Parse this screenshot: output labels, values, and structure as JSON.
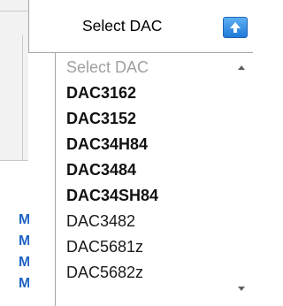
{
  "combo": {
    "selected": "Select DAC",
    "button_icon": "arrow-up-icon",
    "button_color": "#1f7ad8"
  },
  "dropdown": {
    "items": [
      {
        "label": "Select DAC",
        "style": "placeholder"
      },
      {
        "label": "DAC3162",
        "style": "bold"
      },
      {
        "label": "DAC3152",
        "style": "bold"
      },
      {
        "label": "DAC34H84",
        "style": "bold"
      },
      {
        "label": "DAC3484",
        "style": "bold"
      },
      {
        "label": "DAC34SH84",
        "style": "bold"
      },
      {
        "label": "DAC3482",
        "style": "normal"
      },
      {
        "label": "DAC5681z",
        "style": "normal"
      },
      {
        "label": "DAC5682z",
        "style": "normal"
      }
    ]
  },
  "background": {
    "link_fragments": [
      "M",
      "M",
      "M",
      "M"
    ],
    "link_color": "#1e63c4"
  }
}
